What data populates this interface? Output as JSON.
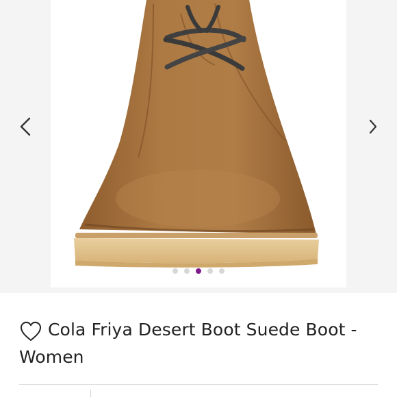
{
  "product": {
    "title": "Cola Friya Desert Boot Suede Boot - Women",
    "image_subject": "tan suede chukka desert boot with dark laces and crepe sole"
  },
  "gallery": {
    "prev_icon": "chevron-left-icon",
    "next_icon": "chevron-right-icon",
    "total_images": 5,
    "active_image_index": 2
  },
  "actions": {
    "like_icon": "heart-outline-icon"
  },
  "colors": {
    "active_dot": "#7f1a8a",
    "inactive_dot": "#d8d8d8",
    "suede": "#a9743f",
    "sole": "#e3c58f"
  }
}
